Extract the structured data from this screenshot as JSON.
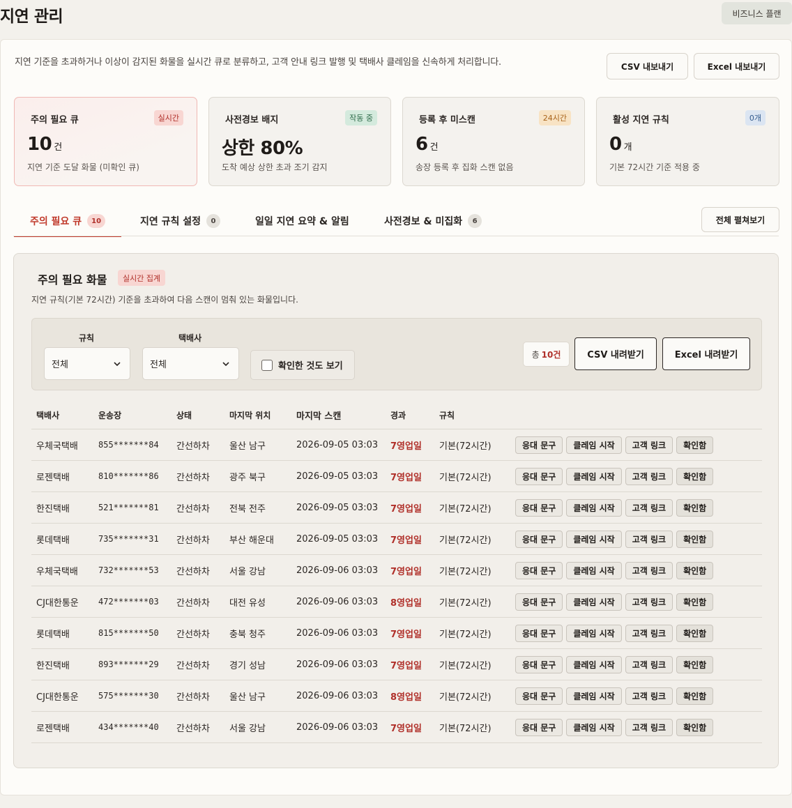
{
  "page": {
    "title": "지연 관리",
    "plan_badge": "비즈니스 플랜",
    "description": "지연 기준을 초과하거나 이상이 감지된 화물을 실시간 큐로 분류하고, 고객 안내 링크 발행 및 택배사 클레임을 신속하게 처리합니다.",
    "export_csv": "CSV 내보내기",
    "export_excel": "Excel 내보내기"
  },
  "cards": [
    {
      "title": "주의 필요 큐",
      "tag": "실시간",
      "value": "10",
      "unit": "건",
      "sub": "지연 기준 도달 화물 (미확인 큐)"
    },
    {
      "title": "사전경보 배지",
      "tag": "작동 중",
      "value": "상한 80%",
      "unit": "",
      "sub": "도착 예상 상한 초과 조기 감지"
    },
    {
      "title": "등록 후 미스캔",
      "tag": "24시간",
      "value": "6",
      "unit": "건",
      "sub": "송장 등록 후 집화 스캔 없음"
    },
    {
      "title": "활성 지연 규칙",
      "tag": "0개",
      "value": "0",
      "unit": "개",
      "sub": "기본 72시간 기준 적용 중"
    }
  ],
  "tabs": [
    {
      "label": "주의 필요 큐",
      "count": "10"
    },
    {
      "label": "지연 규칙 설정",
      "count": "0"
    },
    {
      "label": "일일 지연 요약 & 알림",
      "count": ""
    },
    {
      "label": "사전경보 & 미집화",
      "count": "6"
    }
  ],
  "expand_all": "전체 펼쳐보기",
  "queue": {
    "title": "주의 필요 화물",
    "tag": "실시간 집계",
    "description": "지연 규칙(기본 72시간) 기준을 초과하여 다음 스캔이 멈춰 있는 화물입니다.",
    "filters": {
      "rule_label": "규칙",
      "rule_value": "전체",
      "carrier_label": "택배사",
      "carrier_value": "전체",
      "show_confirmed": "확인한 것도 보기"
    },
    "total_prefix": "총",
    "total_value": "10건",
    "download_csv": "CSV 내려받기",
    "download_excel": "Excel 내려받기",
    "columns": [
      "택배사",
      "운송장",
      "상태",
      "마지막 위치",
      "마지막 스캔",
      "경과",
      "규칙"
    ],
    "actions": [
      "응대 문구",
      "클레임 시작",
      "고객 링크",
      "확인함"
    ],
    "rows": [
      {
        "carrier": "우체국택배",
        "tracking": "855*******84",
        "status": "간선하차",
        "location": "울산 남구",
        "last_scan": "2026-09-05 03:03",
        "elapsed": "7영업일",
        "rule": "기본(72시간)"
      },
      {
        "carrier": "로젠택배",
        "tracking": "810*******86",
        "status": "간선하차",
        "location": "광주 북구",
        "last_scan": "2026-09-05 03:03",
        "elapsed": "7영업일",
        "rule": "기본(72시간)"
      },
      {
        "carrier": "한진택배",
        "tracking": "521*******81",
        "status": "간선하차",
        "location": "전북 전주",
        "last_scan": "2026-09-05 03:03",
        "elapsed": "7영업일",
        "rule": "기본(72시간)"
      },
      {
        "carrier": "롯데택배",
        "tracking": "735*******31",
        "status": "간선하차",
        "location": "부산 해운대",
        "last_scan": "2026-09-05 03:03",
        "elapsed": "7영업일",
        "rule": "기본(72시간)"
      },
      {
        "carrier": "우체국택배",
        "tracking": "732*******53",
        "status": "간선하차",
        "location": "서울 강남",
        "last_scan": "2026-09-06 03:03",
        "elapsed": "7영업일",
        "rule": "기본(72시간)"
      },
      {
        "carrier": "CJ대한통운",
        "tracking": "472*******03",
        "status": "간선하차",
        "location": "대전 유성",
        "last_scan": "2026-09-06 03:03",
        "elapsed": "8영업일",
        "rule": "기본(72시간)"
      },
      {
        "carrier": "롯데택배",
        "tracking": "815*******50",
        "status": "간선하차",
        "location": "충북 청주",
        "last_scan": "2026-09-06 03:03",
        "elapsed": "7영업일",
        "rule": "기본(72시간)"
      },
      {
        "carrier": "한진택배",
        "tracking": "893*******29",
        "status": "간선하차",
        "location": "경기 성남",
        "last_scan": "2026-09-06 03:03",
        "elapsed": "7영업일",
        "rule": "기본(72시간)"
      },
      {
        "carrier": "CJ대한통운",
        "tracking": "575*******30",
        "status": "간선하차",
        "location": "울산 남구",
        "last_scan": "2026-09-06 03:03",
        "elapsed": "8영업일",
        "rule": "기본(72시간)"
      },
      {
        "carrier": "로젠택배",
        "tracking": "434*******40",
        "status": "간선하차",
        "location": "서울 강남",
        "last_scan": "2026-09-06 03:03",
        "elapsed": "7영업일",
        "rule": "기본(72시간)"
      }
    ]
  },
  "colors": {
    "accent": "#c0392b",
    "late_text": "#b0302a",
    "background": "#f3f1ec"
  }
}
